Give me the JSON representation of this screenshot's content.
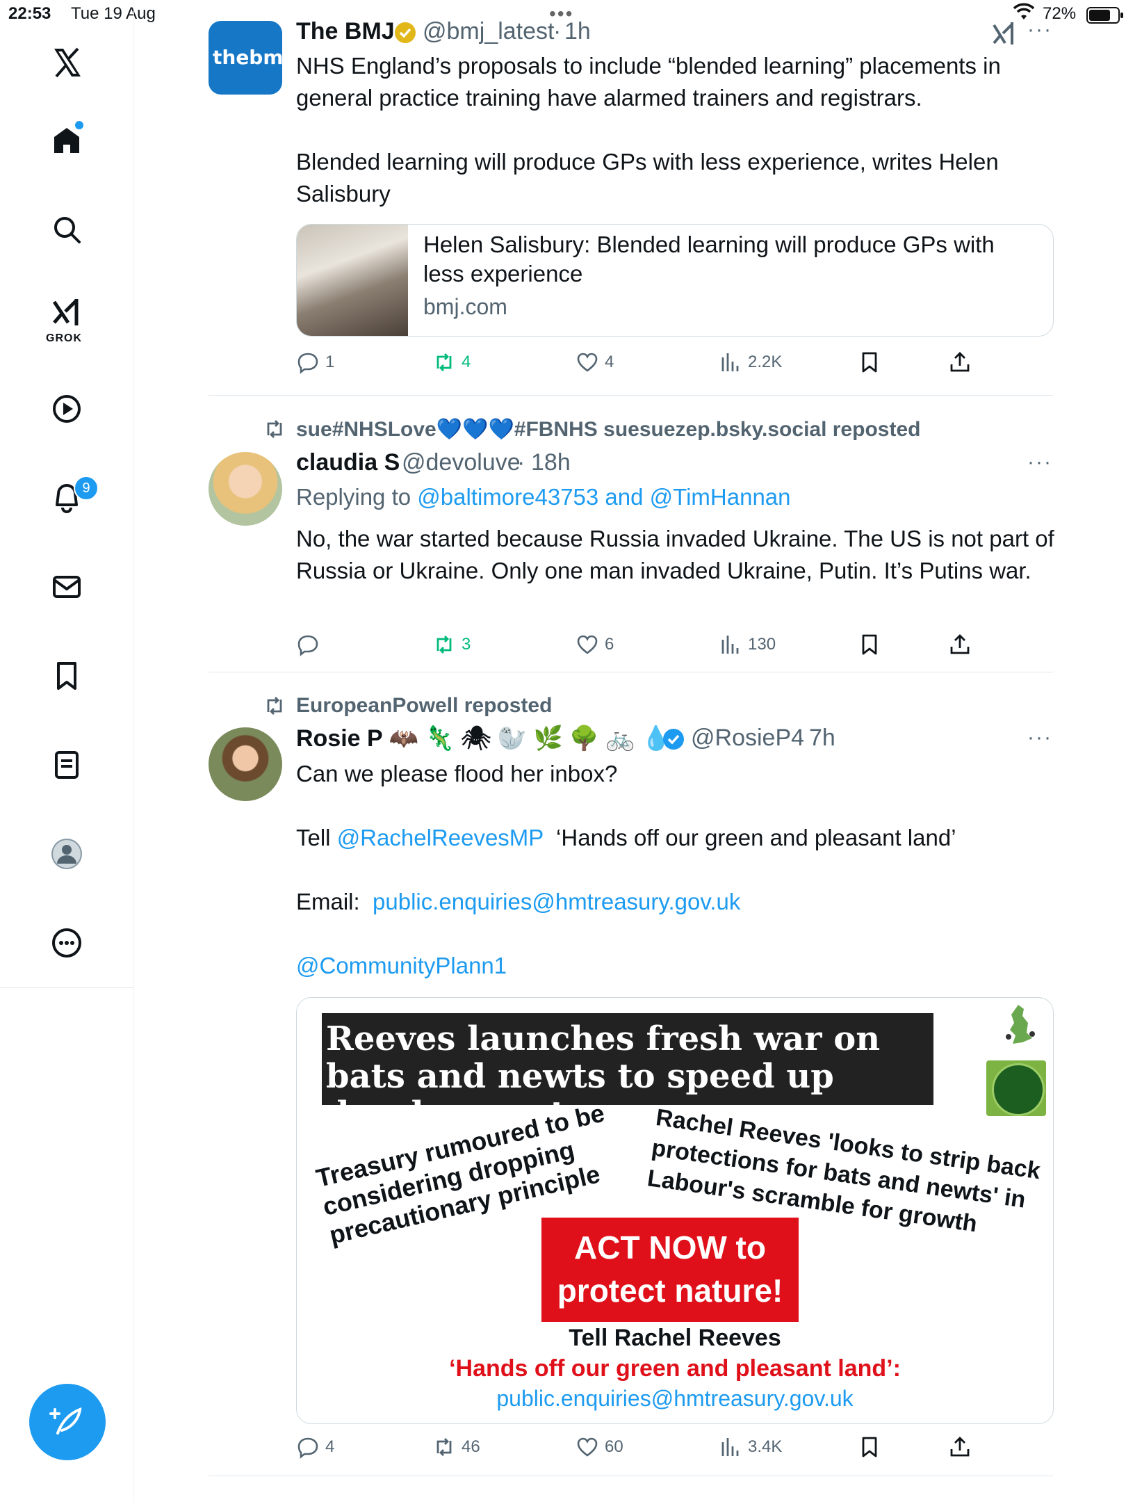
{
  "status_bar": {
    "time": "22:53",
    "date": "Tue 19 Aug",
    "battery": "72%",
    "dots": "•••"
  },
  "sidebar": {
    "logo": "X",
    "grok_label": "GROK",
    "notifications_badge": "9",
    "items": [
      "home-icon",
      "search-icon",
      "grok-icon",
      "video-icon",
      "notifications-icon",
      "messages-icon",
      "bookmarks-icon",
      "lists-icon",
      "profile-icon",
      "more-icon"
    ]
  },
  "tweets": [
    {
      "name": "The BMJ",
      "handle": "@bmj_latest",
      "time": "1h",
      "avatar_text": "thebmj",
      "body": "NHS England’s proposals to include “blended learning” placements in general practice training have alarmed trainers and registrars.\n\nBlended learning will produce GPs with less experience, writes Helen Salisbury",
      "card": {
        "title": "Helen Salisbury: Blended learning will produce GPs with less experience",
        "domain": "bmj.com"
      },
      "stats": {
        "replies": "1",
        "reposts": "4",
        "likes": "4",
        "views": "2.2K"
      }
    },
    {
      "repost_by": "sue#NHSLove💙💙💙#FBNHS suesuezep.bsky.social reposted",
      "name": "claudia S",
      "handle": "@devoluve",
      "time": "18h",
      "replying_prefix": "Replying to ",
      "replying_to": "@baltimore43753 and @TimHannan",
      "body": "No, the war started because Russia invaded Ukraine. The US is not part of Russia or Ukraine. Only one man invaded Ukraine, Putin. It’s Putins war.",
      "stats": {
        "replies": "",
        "reposts": "3",
        "likes": "6",
        "views": "130"
      }
    },
    {
      "repost_by": "EuropeanPowell reposted",
      "name": "Rosie P 🦇 🦎 🕷 🦭 🌿 🌳 🚲 💧",
      "handle": "@RosieP4",
      "time": "7h",
      "body_line1": "Can we please flood her inbox?",
      "body_tell": "Tell ",
      "body_mention": "@RachelReevesMP",
      "body_quote": "  ‘Hands off our green and pleasant land’",
      "body_email_label": "Email:  ",
      "body_email": "public.enquiries@hmtreasury.gov.uk",
      "body_mention2": "@CommunityPlann1",
      "media": {
        "headline": "Reeves launches fresh war on bats and newts to speed up development",
        "left_text": "Treasury rumoured to be considering dropping precautionary principle",
        "right_text": "Rachel Reeves 'looks to strip back protections for bats and newts' in Labour's scramble for growth",
        "act_now": "ACT NOW to protect nature!",
        "tell": "Tell Rachel Reeves",
        "hands": "‘Hands off our green and pleasant land’:",
        "email": "public.enquiries@hmtreasury.gov.uk"
      },
      "stats": {
        "replies": "4",
        "reposts": "46",
        "likes": "60",
        "views": "3.4K"
      }
    }
  ],
  "colors": {
    "accent": "#1d9bf0",
    "repost_green": "#00ba7c",
    "muted": "#536471",
    "alert_red": "#e0101a"
  }
}
